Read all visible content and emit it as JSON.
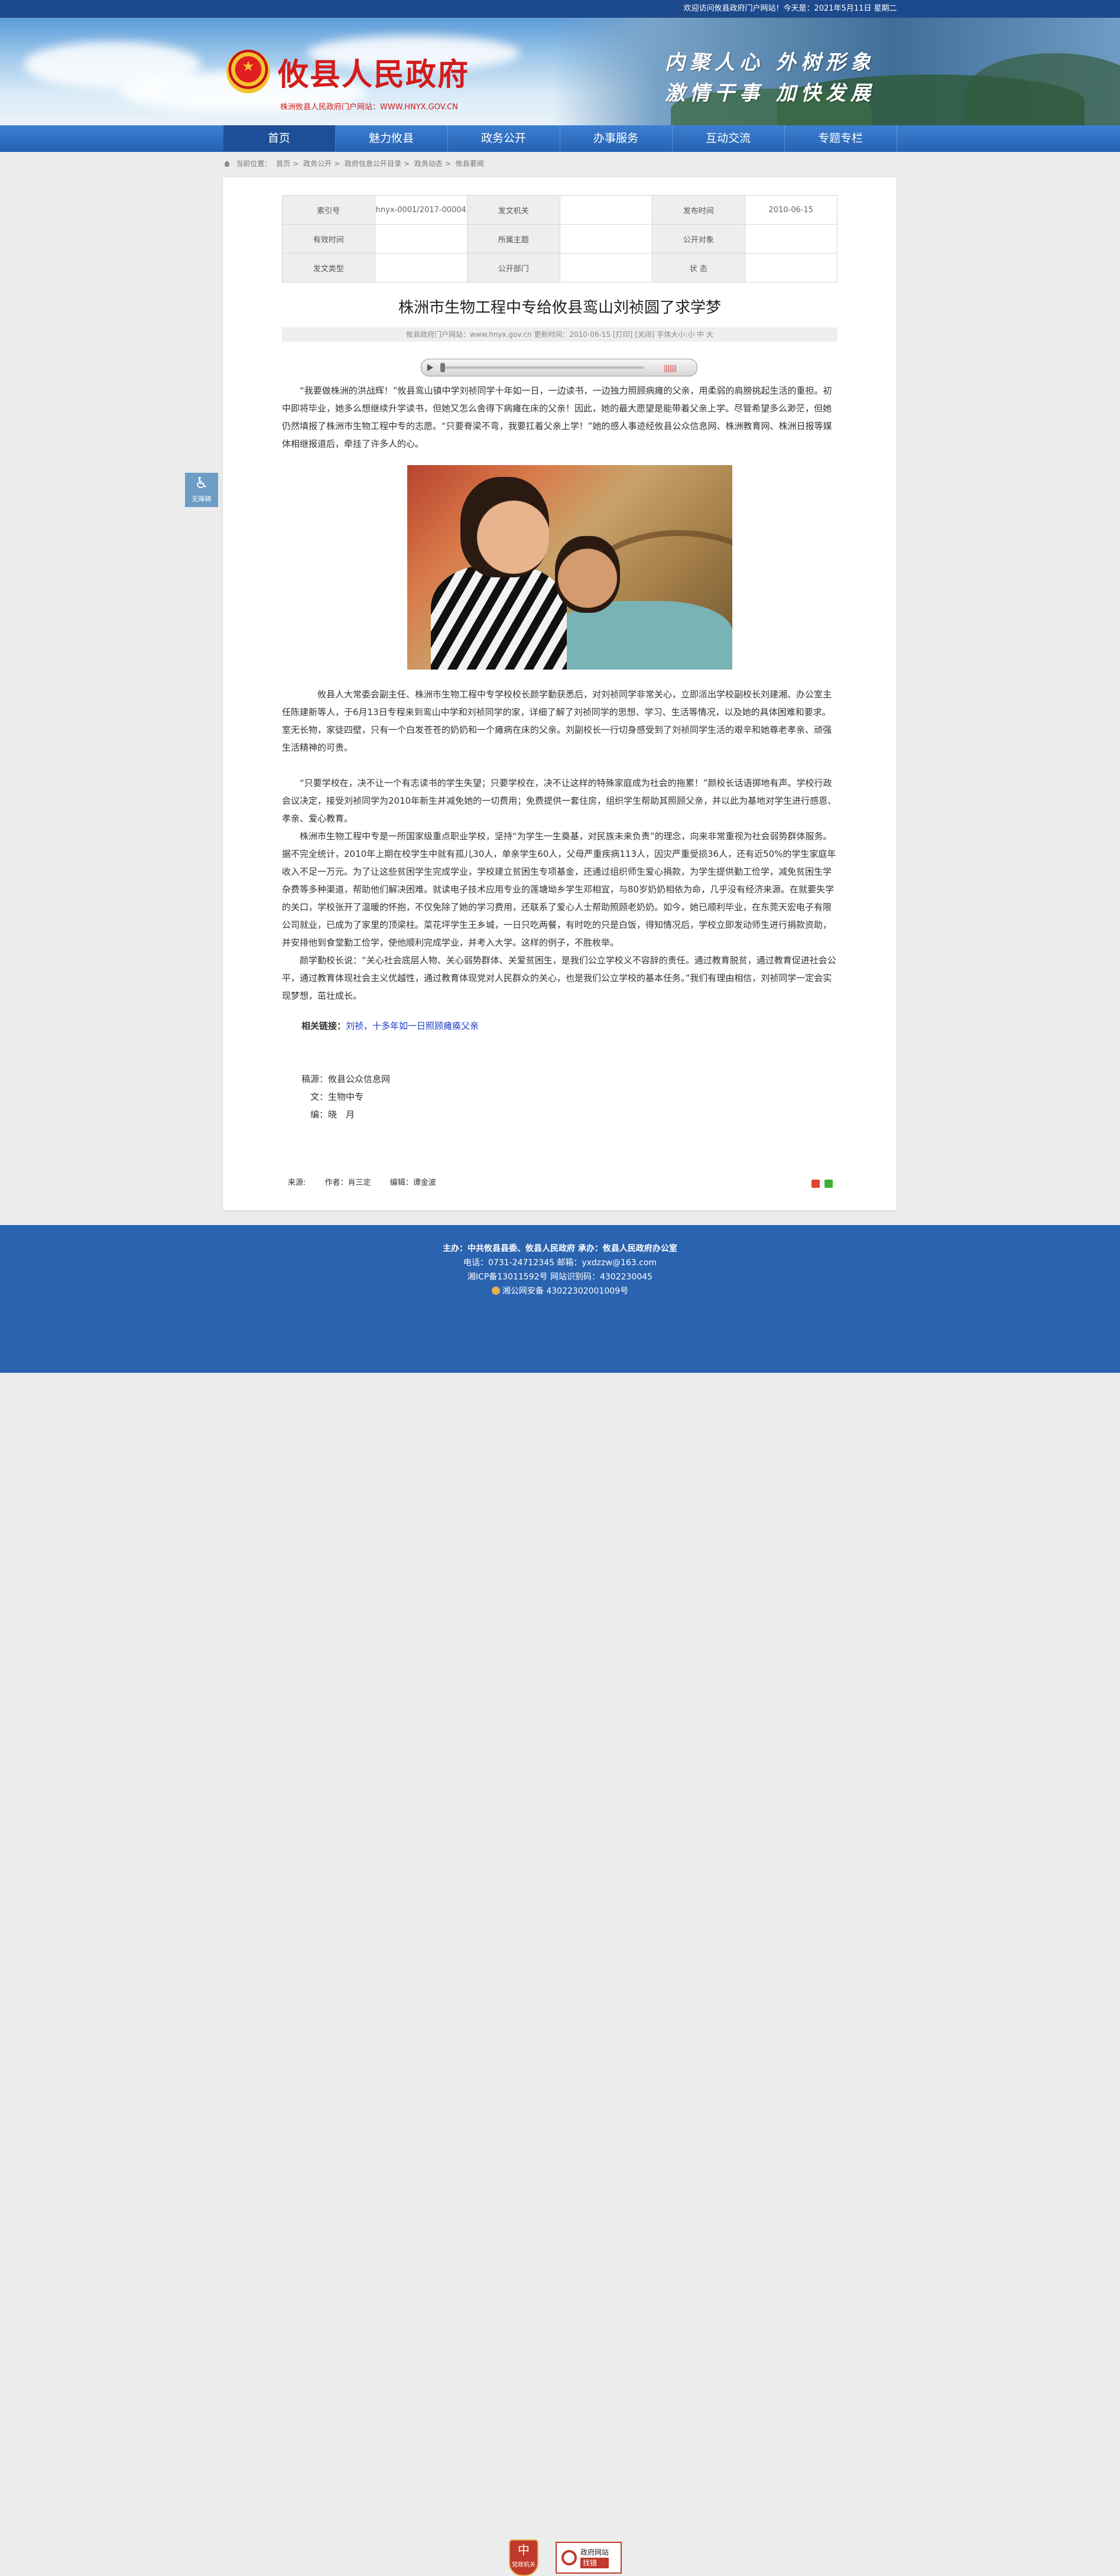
{
  "topbar": {
    "welcome": "欢迎访问攸县政府门户网站！今天是：2021年5月11日 星期二"
  },
  "header": {
    "site_title": "攸县人民政府",
    "site_sub": "株洲攸县人民政府门户网站：WWW.HNYX.GOV.CN",
    "slogan_1": "内聚人心  外树形象",
    "slogan_2": "激情干事  加快发展"
  },
  "nav": {
    "items": [
      {
        "label": "首页"
      },
      {
        "label": "魅力攸县"
      },
      {
        "label": "政务公开"
      },
      {
        "label": "办事服务"
      },
      {
        "label": "互动交流"
      },
      {
        "label": "专题专栏"
      }
    ]
  },
  "breadcrumb": {
    "prefix": "当前位置：",
    "items": [
      "首页",
      "政务公开",
      "政府信息公开目录",
      "政务动态",
      "攸县要闻"
    ],
    "sep": ">"
  },
  "meta": {
    "index_label": "索引号",
    "index_value": "hnyx-0001/2017-00004",
    "issuer_label": "发文机关",
    "issuer_value": "",
    "pubdate_label": "发布时间",
    "pubdate_value": "2010-06-15",
    "valid_label": "有效时间",
    "valid_value": "",
    "topic_label": "所属主题",
    "topic_value": "",
    "audience_label": "公开对象",
    "audience_value": "",
    "doctype_label": "发文类型",
    "doctype_value": "",
    "dept_label": "公开部门",
    "dept_value": "",
    "status_label": "状 态",
    "status_value": ""
  },
  "article": {
    "title": "株洲市生物工程中专给攸县鸾山刘祯圆了求学梦",
    "infobar": "攸县政府门户网站：www.hnyx.gov.cn  更新时间：2010-06-15  [打印] [关闭]  字体大小:小 中 大",
    "p1": "“我要做株洲的洪战辉！”攸县鸾山镇中学刘祯同学十年如一日，一边读书，一边独力照顾病瘫的父亲，用柔弱的肩膀挑起生活的重担。初中即将毕业，她多么想继续升学读书，但她又怎么舍得下病瘫在床的父亲！因此，她的最大愿望是能带着父亲上学。尽管希望多么渺茫，但她仍然填报了株洲市生物工程中专的志愿。“只要脊梁不弯，我要扛着父亲上学！”她的感人事迹经攸县公众信息网、株洲教育网、株洲日报等媒体相继报道后，牵挂了许多人的心。",
    "p2": "攸县人大常委会副主任、株洲市生物工程中专学校校长颜学勤获悉后，对刘祯同学非常关心，立即派出学校副校长刘建湘、办公室主任陈建新等人，于6月13日专程来到鸾山中学和刘祯同学的家，详细了解了刘祯同学的思想、学习、生活等情况，以及她的具体困难和要求。室无长物，家徒四壁，只有一个白发苍苍的奶奶和一个瘫病在床的父亲。刘副校长一行切身感受到了刘祯同学生活的艰辛和她尊老孝亲、顽强生活精神的可贵。",
    "p3": "“只要学校在，决不让一个有志读书的学生失望；只要学校在，决不让这样的特殊家庭成为社会的拖累！”颜校长话语掷地有声。学校行政会议决定，接受刘祯同学为2010年新生并减免她的一切费用；免费提供一套住房，组织学生帮助其照顾父亲，并以此为基地对学生进行感恩、孝亲、爱心教育。",
    "p4": "株洲市生物工程中专是一所国家级重点职业学校，坚持“为学生一生奠基，对民族未来负责”的理念，向来非常重视为社会弱势群体服务。据不完全统计，2010年上期在校学生中就有孤儿30人，单亲学生60人，父母严重疾病113人，因灾严重受损36人，还有近50%的学生家庭年收入不足一万元。为了让这些贫困学生完成学业，学校建立贫困生专项基金，还通过组织师生爱心捐款，为学生提供勤工俭学，减免贫困生学杂费等多种渠道，帮助他们解决困难。就读电子技术应用专业的莲塘坳乡学生邓相宜，与80岁奶奶相依为命，几乎没有经济来源。在就要失学的关口，学校张开了温暖的怀抱，不仅免除了她的学习费用，还联系了爱心人士帮助照顾老奶奶。如今，她已顺利毕业，在东莞天宏电子有限公司就业，已成为了家里的顶梁柱。菜花坪学生王乡城，一日只吃两餐，有时吃的只是白饭，得知情况后，学校立即发动师生进行捐款资助，并安排他到食堂勤工俭学，使他顺利完成学业，并考入大学。这样的例子，不胜枚举。",
    "p5": "颜学勤校长说：“关心社会底层人物、关心弱势群体、关爱贫困生，是我们公立学校义不容辞的责任。通过教育脱贫，通过教育促进社会公平，通过教育体现社会主义优越性，通过教育体现党对人民群众的关心，也是我们公立学校的基本任务。”我们有理由相信，刘祯同学一定会实现梦想，茁壮成长。",
    "related_label": "相关链接：",
    "related_link": "刘祯，十多年如一日照顾瘫痪父亲",
    "credit_source": "稿源：攸县公众信息网",
    "credit_text": "文：生物中专",
    "credit_editor": "编：晓　月",
    "foot_source": "来源:",
    "foot_author": "作者：肖三定",
    "foot_editor": "编辑：谭金波"
  },
  "accessibility": {
    "label": "无障碍"
  },
  "footer": {
    "line1": "主办：中共攸县县委、攸县人民政府 承办：攸县人民政府办公室",
    "line2": "电话：0731-24712345 邮箱：yxdzzw@163.com",
    "line3": "湘ICP备13011592号   网站识别码：4302230045",
    "line4": "湘公网安备 43022302001009号",
    "badge1": "党政机关",
    "badge2_top": "政府网站",
    "badge2_bottom": "找错"
  }
}
